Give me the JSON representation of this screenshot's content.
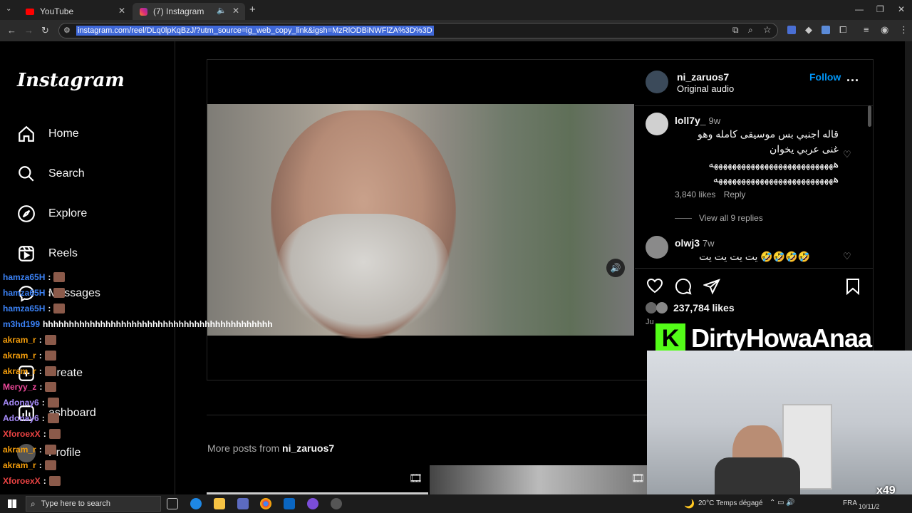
{
  "browser": {
    "tabs": [
      {
        "label": "YouTube"
      },
      {
        "label": "(7) Instagram"
      }
    ],
    "new_tab": "+",
    "url": "instagram.com/reel/DLq0lpKqBzJ/?utm_source=ig_web_copy_link&igsh=MzRlODBiNWFlZA%3D%3D"
  },
  "sidebar": {
    "logo": "Instagram",
    "items": [
      {
        "label": "Home",
        "icon": "home-icon"
      },
      {
        "label": "Search",
        "icon": "search-icon"
      },
      {
        "label": "Explore",
        "icon": "compass-icon"
      },
      {
        "label": "Reels",
        "icon": "reels-icon"
      },
      {
        "label": "Messages",
        "icon": "messenger-icon"
      },
      {
        "label": "Create",
        "icon": "plus-square-icon"
      },
      {
        "label": "ashboard",
        "icon": "dashboard-icon"
      },
      {
        "label": "Profile",
        "icon": "avatar"
      }
    ]
  },
  "post": {
    "author": "ni_zaruos7",
    "audio": "Original audio",
    "follow": "Follow",
    "more": "...",
    "comments": [
      {
        "user": "loll7y_",
        "time": "9w",
        "text_line1": "قاله اجنبي بس موسيقى كامله وهو",
        "text_line2": "غنى عربي يخوان",
        "text_line3": "هههههههههههههههههههههههههههه",
        "text_line4": "ههههههههههههههههههههههههههه",
        "likes": "3,840 likes",
        "reply": "Reply",
        "view_replies": "View all 9 replies"
      },
      {
        "user": "olwj3",
        "time": "7w",
        "text": "🤣🤣🤣🤣 يت يت يت يت"
      }
    ],
    "likes": "237,784 likes",
    "date_partial": "Ju"
  },
  "more_posts": {
    "label": "More posts from",
    "user": "ni_zaruos7"
  },
  "chat_overlay": [
    {
      "user": "hamza65H",
      "color": "#3b82f6",
      "text": ":"
    },
    {
      "user": "hamza65H",
      "color": "#3b82f6",
      "text": ":"
    },
    {
      "user": "hamza65H",
      "color": "#3b82f6",
      "text": ":"
    },
    {
      "user": "m3hd199",
      "color": "#3b82f6",
      "text": "hhhhhhhhhhhhhhhhhhhhhhhhhhhhhhhhhhhhhhhhhhhh"
    },
    {
      "user": "akram_r",
      "color": "#f59e0b",
      "text": ":"
    },
    {
      "user": "akram_r",
      "color": "#f59e0b",
      "text": ":"
    },
    {
      "user": "akram_r",
      "color": "#f59e0b",
      "text": ":"
    },
    {
      "user": "Meryy_z",
      "color": "#ec4899",
      "text": ":"
    },
    {
      "user": "Adonay6",
      "color": "#a78bfa",
      "text": ":"
    },
    {
      "user": "Adonay6",
      "color": "#a78bfa",
      "text": ":"
    },
    {
      "user": "XforoexX",
      "color": "#ef4444",
      "text": ":"
    },
    {
      "user": "akram_r",
      "color": "#f59e0b",
      "text": ":"
    },
    {
      "user": "akram_r",
      "color": "#f59e0b",
      "text": ":"
    },
    {
      "user": "XforoexX",
      "color": "#ef4444",
      "text": ":"
    }
  ],
  "stream": {
    "platform_letter": "K",
    "channel": "DirtyHowaAnaa",
    "viewer_count": "x49"
  },
  "taskbar": {
    "search_placeholder": "Type here to search",
    "weather": "20°C  Temps dégagé",
    "lang": "FRA",
    "date": "10/11/2"
  },
  "colors": {
    "follow": "#0095f6",
    "kick_green": "#53fc18",
    "url_highlight": "#3f68d8"
  }
}
